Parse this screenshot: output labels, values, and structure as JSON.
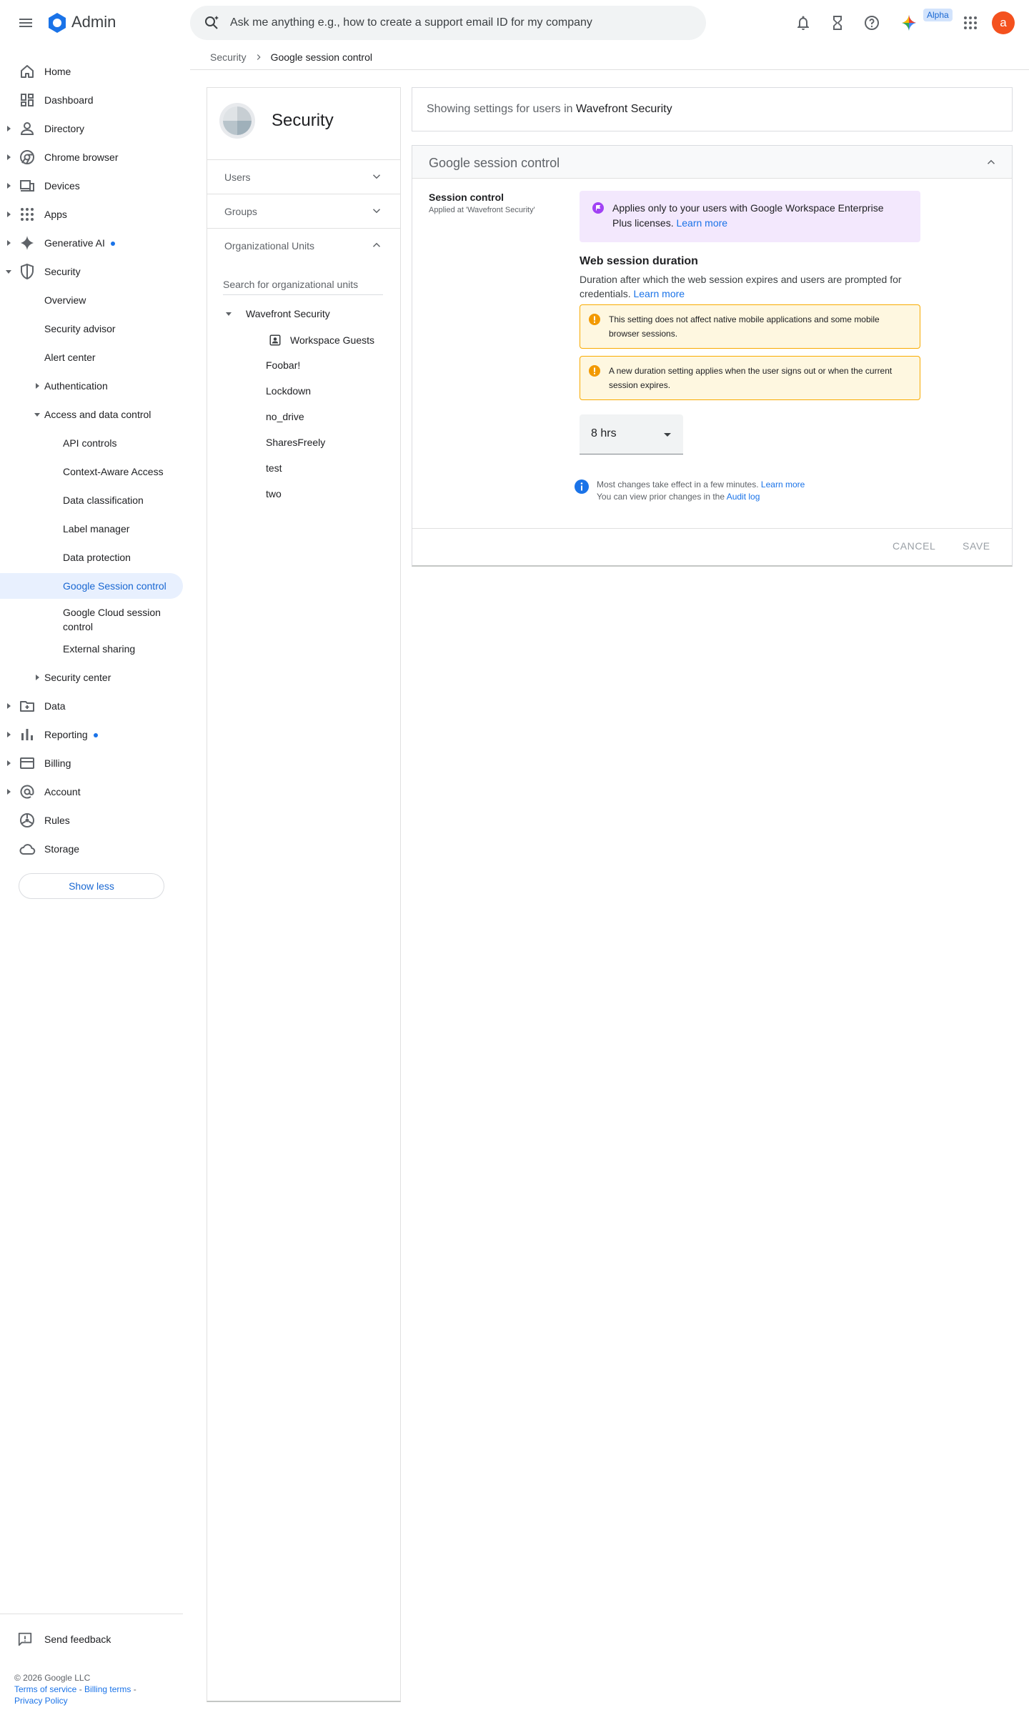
{
  "header": {
    "app_name": "Admin",
    "search_placeholder": "Ask me anything e.g., how to create a support email ID for my company",
    "alpha_badge": "Alpha",
    "avatar_letter": "a",
    "brand_color": "#1a73e8"
  },
  "breadcrumb": {
    "root": "Security",
    "current": "Google session control"
  },
  "nav": {
    "items": [
      {
        "label": "Home",
        "icon": "home-icon"
      },
      {
        "label": "Dashboard",
        "icon": "dashboard-icon"
      },
      {
        "label": "Directory",
        "icon": "person-icon"
      },
      {
        "label": "Chrome browser",
        "icon": "chrome-icon"
      },
      {
        "label": "Devices",
        "icon": "devices-icon"
      },
      {
        "label": "Apps",
        "icon": "apps-grid-icon"
      },
      {
        "label": "Generative AI",
        "icon": "sparkle-icon"
      },
      {
        "label": "Security",
        "icon": "shield-icon"
      }
    ],
    "security_sub": [
      "Overview",
      "Security advisor",
      "Alert center",
      "Authentication",
      "Access and data control"
    ],
    "access_sub": [
      "API controls",
      "Context-Aware Access",
      "Data classification",
      "Label manager",
      "Data protection",
      "Google Session control",
      "Google Cloud session control",
      "External sharing"
    ],
    "security_center": "Security center",
    "bottom_items": [
      {
        "label": "Data",
        "icon": "folder-icon"
      },
      {
        "label": "Reporting",
        "icon": "bar-chart-icon"
      },
      {
        "label": "Billing",
        "icon": "credit-card-icon"
      },
      {
        "label": "Account",
        "icon": "at-sign-icon"
      },
      {
        "label": "Rules",
        "icon": "rules-icon"
      },
      {
        "label": "Storage",
        "icon": "cloud-icon"
      }
    ],
    "show_less": "Show less",
    "send_feedback": "Send feedback"
  },
  "footer": {
    "copyright": "© 2026 Google LLC",
    "terms": "Terms of service",
    "billing_terms": "Billing terms",
    "privacy": "Privacy Policy"
  },
  "panel": {
    "title": "Security",
    "sections": [
      "Users",
      "Groups",
      "Organizational Units"
    ],
    "ou_search_placeholder": "Search for organizational units",
    "ou_root": "Wavefront Security",
    "ou_guests": "Workspace Guests",
    "ou_children": [
      "Foobar!",
      "Lockdown",
      "no_drive",
      "SharesFreely",
      "test",
      "two"
    ]
  },
  "content": {
    "showing_prefix": "Showing settings for users in",
    "showing_org": "Wavefront Security",
    "card_title": "Google session control",
    "session_label": "Session control",
    "applied_at": "Applied at 'Wavefront Security'",
    "license_note": "Applies only to your users with Google Workspace Enterprise Plus licenses.",
    "learn_more": "Learn more",
    "wsd_title": "Web session duration",
    "wsd_desc": "Duration after which the web session expires and users are prompted for credentials.",
    "warning_1": "This setting does not affect native mobile applications and some mobile browser sessions.",
    "warning_2": "A new duration setting applies when the user signs out or when the current session expires.",
    "duration_value": "8 hrs",
    "info_line1": "Most changes take effect in a few minutes.",
    "info_line2": "You can view prior changes in the",
    "audit_log": "Audit log",
    "cancel": "CANCEL",
    "save": "SAVE"
  }
}
